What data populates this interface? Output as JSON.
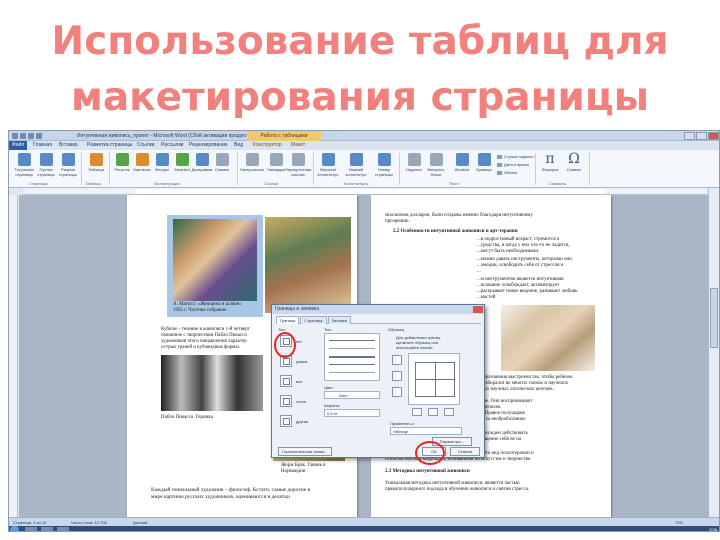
{
  "slide": {
    "title_line1": "Использование таблиц для",
    "title_line2": "макетирования страницы"
  },
  "window": {
    "title": "Интуитивная живопись_проект - Microsoft Word (Сбой активации продукта)",
    "context_tab": "Работа с таблицами"
  },
  "ribbon": {
    "tabs": [
      "Файл",
      "Главная",
      "Вставка",
      "Разметка страницы",
      "Ссылки",
      "Рассылки",
      "Рецензирование",
      "Вид",
      "Конструктор",
      "Макет"
    ],
    "buttons": [
      {
        "label": "Титульная страница",
        "icon": "page-icon"
      },
      {
        "label": "Пустая страница",
        "icon": "page-icon"
      },
      {
        "label": "Разрыв страницы",
        "icon": "page-icon"
      },
      {
        "label": "Таблица",
        "icon": "table-icon"
      },
      {
        "label": "Рисунок",
        "icon": "picture-icon"
      },
      {
        "label": "Картинка",
        "icon": "clipart-icon"
      },
      {
        "label": "Фигуры",
        "icon": "shapes-icon"
      },
      {
        "label": "SmartArt",
        "icon": "smartart-icon"
      },
      {
        "label": "Диаграмма",
        "icon": "chart-icon"
      },
      {
        "label": "Снимок",
        "icon": "screenshot-icon"
      },
      {
        "label": "Гиперссылка",
        "icon": "link-icon"
      },
      {
        "label": "Закладка",
        "icon": "bookmark-icon"
      },
      {
        "label": "Перекрестная ссылка",
        "icon": "crossref-icon"
      },
      {
        "label": "Верхний колонтитул",
        "icon": "header-icon"
      },
      {
        "label": "Нижний колонтитул",
        "icon": "footer-icon"
      },
      {
        "label": "Номер страницы",
        "icon": "pagenum-icon"
      },
      {
        "label": "Надпись",
        "icon": "textbox-icon"
      },
      {
        "label": "Экспресс-блоки",
        "icon": "quickparts-icon"
      },
      {
        "label": "WordArt",
        "icon": "wordart-icon"
      },
      {
        "label": "Буквица",
        "icon": "dropcap-icon"
      },
      {
        "label": "Формула",
        "icon": "pi-icon"
      },
      {
        "label": "Символ",
        "icon": "omega-icon"
      }
    ],
    "small_buttons": [
      "Строка подписи",
      "Дата и время",
      "Объект"
    ],
    "groups": [
      "Страницы",
      "Таблицы",
      "Иллюстрации",
      "Ссылки",
      "Колонтитулы",
      "Текст",
      "Символы"
    ]
  },
  "document": {
    "left_page": {
      "caption": [
        "А. Матисс: «Женщина в шляпе»",
        "1905 г. Частное собрание"
      ],
      "text": [
        "Кубизм – течение в живописи 1-й четверт",
        "связанное с творчеством Пабло Пикассо",
        "художников этого направления характер",
        "острых граней и кубовидные формы."
      ],
      "caption2": "Пабло Пикассо. Герника",
      "caption3": [
        "Жорж Брак. Гавань в",
        "Нормандии"
      ],
      "footer": [
        "Каждый гениальный художник – философ. Кстати, самые дорогие в",
        "мире картины русских художников, оцениваются в десятки"
      ]
    },
    "right_page": {
      "lines": [
        "миллионов долларов, были созданы именно благодаря интуитивному",
        "прозрению.",
        "2.2 Особенности интуитивной живописи и арт-терапии",
        "...в подростковый возраст, стремится к",
        "...средства, и когда у них что-то не ладится,",
        "...могут быть необходимыми.",
        "...можно давать инструменты, которыми они",
        "...эмоции, освободить себя от стрессов и",
        "...",
        "...м инструментом является интуитивная",
        "...исование освобождает, активизирует",
        "...раскрывает новое видение, развивает любовь",
        "...мастей."
      ],
      "lines2": [
        "...образования выстроена так, чтобы ребенок",
        "...разбирался во многих схемах и научился",
        "...ных научных логических цепочек.",
        "Собственную жизнь в этом контексте не",
        "...Изначально же все малыши правополушарные. Они воспринимают",
        "мир «как он есть», не выстраивая логических цепочек.",
        "Увидел – исследовал, понюхал, получил опыт. Правое полушарие",
        "головного мозга отвечает за образное видение, за необработанное",
        "общение с миром и за интуицию.",
        "От рождения правополушарный мыслитель вынужден действовать",
        "как левополушарный. Как итог – стрессы, ощущение себя не на",
        "своем месте, болезни, депрессии.",
        "Эти проблемы помогает решить арт-терапия. Это вид психотерапии и",
        "психологической коррекции, основанный на искусстве и творчестве.",
        "2.3 Методика интуитивной живописи",
        "Уникальная методика интуитивной живописи, является частью",
        "правополушарного подхода в обучении живописи и снятия стресса."
      ]
    }
  },
  "dialog": {
    "title": "Границы и заливка",
    "tabs": [
      "Граница",
      "Страница",
      "Заливка"
    ],
    "settings_label": "Тип:",
    "settings": [
      "нет",
      "рамка",
      "все",
      "сетка",
      "другая"
    ],
    "type_label": "Тип:",
    "color_label": "Цвет:",
    "color_value": "Авто",
    "width_label": "Ширина:",
    "width_value": "0,5 пт",
    "preview_label": "Образец",
    "preview_hint": [
      "Для добавления границ",
      "щелкните образец или",
      "используйте кнопки"
    ],
    "apply_label": "Применить к:",
    "apply_value": "таблице",
    "params_button": "Параметры...",
    "hline_button": "Горизонтальная линия...",
    "ok_button": "ОК",
    "cancel_button": "Отмена"
  },
  "status": {
    "page": "Страница: 5 из 10",
    "words": "Число слов: 12 796",
    "lang": "русский",
    "zoom": "70%",
    "time": "3:36"
  },
  "colors": {
    "title": "#f0817d",
    "highlight_circle": "#e82424"
  }
}
